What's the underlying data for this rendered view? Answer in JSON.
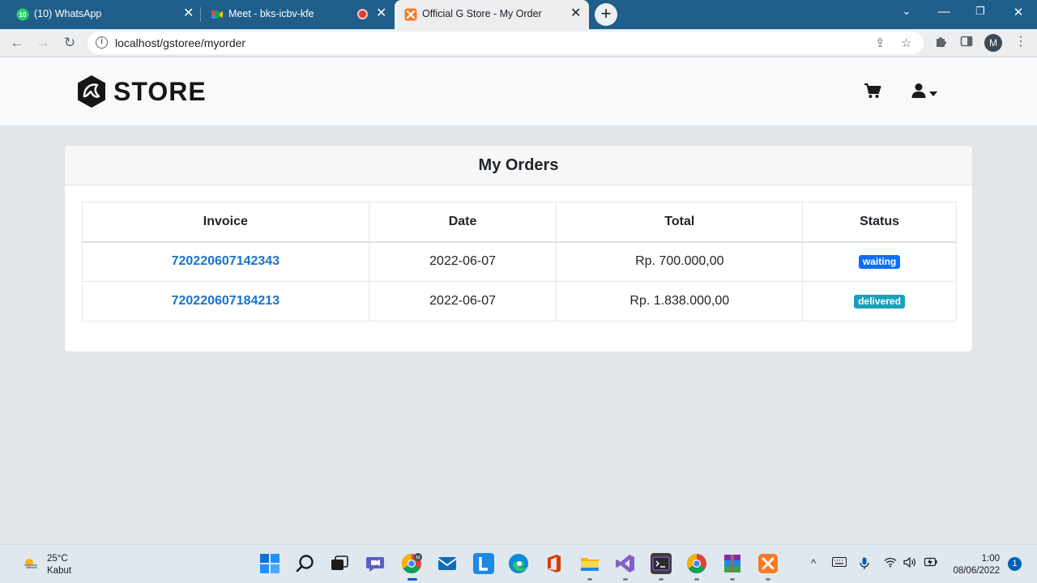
{
  "browser": {
    "tabs": [
      {
        "title": "(10) WhatsApp",
        "badge": "10",
        "active": false
      },
      {
        "title": "Meet - bks-icbv-kfe",
        "active": false
      },
      {
        "title": "Official G Store - My Order",
        "active": true
      }
    ],
    "url": "localhost/gstoree/myorder",
    "profile_initial": "M"
  },
  "navbar": {
    "logo_text": "STORE",
    "icons": [
      "cart-icon",
      "user-icon",
      "caret-down-icon"
    ]
  },
  "orders": {
    "title": "My Orders",
    "columns": [
      "Invoice",
      "Date",
      "Total",
      "Status"
    ],
    "rows": [
      {
        "invoice": "720220607142343",
        "date": "2022-06-07",
        "total": "Rp. 700.000,00",
        "status": "waiting",
        "status_color": "#0d6efd"
      },
      {
        "invoice": "720220607184213",
        "date": "2022-06-07",
        "total": "Rp. 1.838.000,00",
        "status": "delivered",
        "status_color": "#17a2b8"
      }
    ]
  },
  "taskbar": {
    "weather_temp": "25°C",
    "weather_desc": "Kabut",
    "time": "1:00",
    "date": "08/06/2022",
    "notifications": "1",
    "chrome_badge": "M"
  }
}
